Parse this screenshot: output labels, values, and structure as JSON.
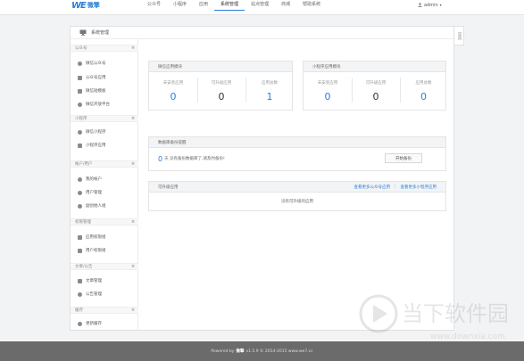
{
  "brand": {
    "mark": "WE",
    "name": "微擎"
  },
  "nav": {
    "items": [
      "公众号",
      "小程序",
      "应用",
      "系统管理",
      "站点管理",
      "商城",
      "帮助系统"
    ],
    "active_index": 3
  },
  "user": {
    "name": "admin"
  },
  "page": {
    "title": "系统管理"
  },
  "side_tab": {
    "label": "常用"
  },
  "sidebar": {
    "groups": [
      {
        "title": "公众号",
        "items": [
          "微信公众号",
          "公众号应用",
          "微信短模板",
          "微信开放平台"
        ]
      },
      {
        "title": "小程序",
        "items": [
          "微信小程序",
          "小程序应用"
        ]
      },
      {
        "title": "帐户/用户",
        "items": [
          "我的帐户",
          "用户管理",
          "副创始人组"
        ]
      },
      {
        "title": "权限管理",
        "items": [
          "应用权限组",
          "用户权限组"
        ]
      },
      {
        "title": "文章/公告",
        "items": [
          "文章管理",
          "公告管理"
        ]
      },
      {
        "title": "缓存",
        "items": [
          "更新缓存"
        ]
      }
    ]
  },
  "wechat_panel": {
    "title": "微信应用模块",
    "stats": [
      {
        "label": "未安装应用",
        "value": "0",
        "color": "blue"
      },
      {
        "label": "可升级应用",
        "value": "0",
        "color": "dark"
      },
      {
        "label": "应用总数",
        "value": "1",
        "color": "blue"
      }
    ]
  },
  "miniapp_panel": {
    "title": "小程序应用模块",
    "stats": [
      {
        "label": "未安装应用",
        "value": "0",
        "color": "blue"
      },
      {
        "label": "可升级应用",
        "value": "0",
        "color": "dark"
      },
      {
        "label": "应用总数",
        "value": "0",
        "color": "blue"
      }
    ]
  },
  "backup_panel": {
    "title": "数据库备份提醒",
    "count": "0",
    "text": "天 没有备份数据库了,请及时备份!",
    "button": "开始备份"
  },
  "upgrade_panel": {
    "title": "可升级应用",
    "link_wechat": "查看更多公众号应用",
    "divider": "|",
    "link_miniapp": "查看更多小程序应用",
    "empty": "没有可升级的应用"
  },
  "footer": {
    "prefix": "Powered by",
    "brand": "微擎",
    "suffix": "v1.5.9 © 2014-2015 www.we7.cc"
  },
  "watermark": {
    "name": "当下软件园",
    "url": "www.downxia.com"
  },
  "colors": {
    "accent": "#2b7fd6",
    "footer_bg": "#6b6b6b"
  }
}
